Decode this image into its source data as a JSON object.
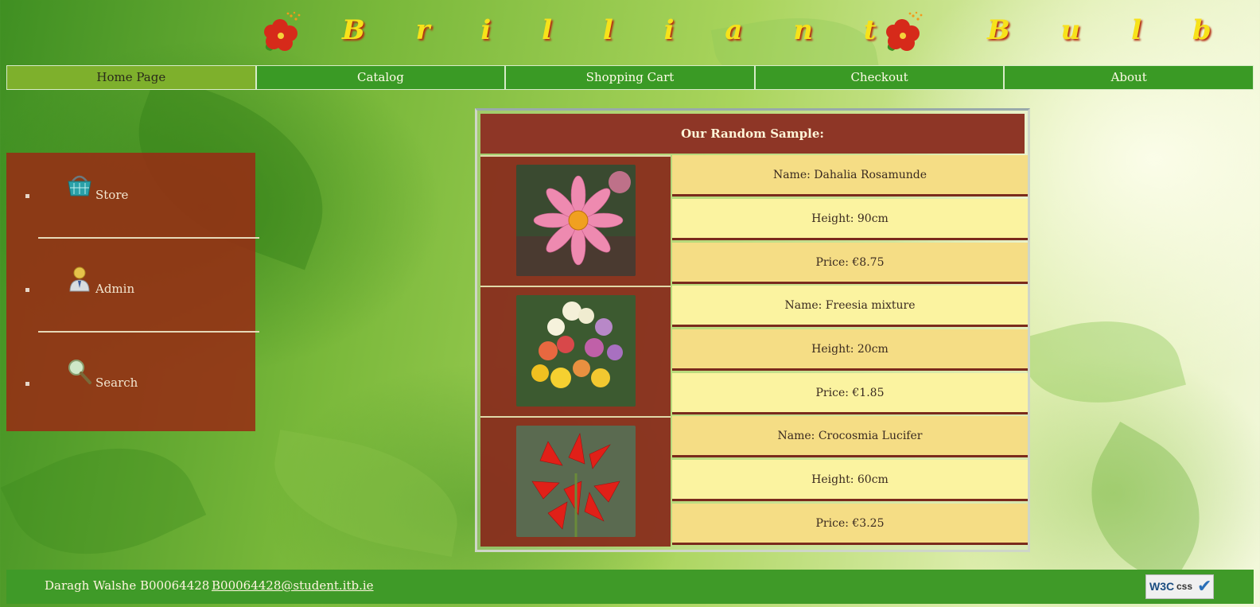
{
  "site": {
    "title": "B r i l l i a n t   B u l b s"
  },
  "nav": {
    "items": [
      {
        "label": "Home Page"
      },
      {
        "label": "Catalog"
      },
      {
        "label": "Shopping Cart"
      },
      {
        "label": "Checkout"
      },
      {
        "label": "About"
      }
    ],
    "active": "Home Page"
  },
  "sidebar": {
    "items": [
      {
        "label": "Store",
        "icon": "basket-icon"
      },
      {
        "label": "Admin",
        "icon": "user-icon"
      },
      {
        "label": "Search",
        "icon": "magnifier-icon"
      }
    ]
  },
  "sample": {
    "heading": "Our Random Sample:",
    "products": [
      {
        "name": "Name: Dahalia Rosamunde",
        "height": "Height: 90cm",
        "price": "Price: €8.75",
        "image": "pink-dahlia-photo"
      },
      {
        "name": "Name: Freesia mixture",
        "height": "Height: 20cm",
        "price": "Price: €1.85",
        "image": "freesia-photo"
      },
      {
        "name": "Name: Crocosmia Lucifer",
        "height": "Height: 60cm",
        "price": "Price: €3.25",
        "image": "red-crocosmia-photo"
      }
    ]
  },
  "footer": {
    "author": "Daragh Walshe B00064428",
    "email": "B00064428@student.itb.ie",
    "badge": {
      "w3c": "W3C",
      "css": "css"
    }
  },
  "colors": {
    "nav_green": "#3a9a25",
    "nav_active": "#7eb02c",
    "sidebar_red": "#962d14",
    "title_yellow": "#f7e21a",
    "info_gold": "#f5dd85",
    "info_yellow": "#fbf3a0"
  }
}
